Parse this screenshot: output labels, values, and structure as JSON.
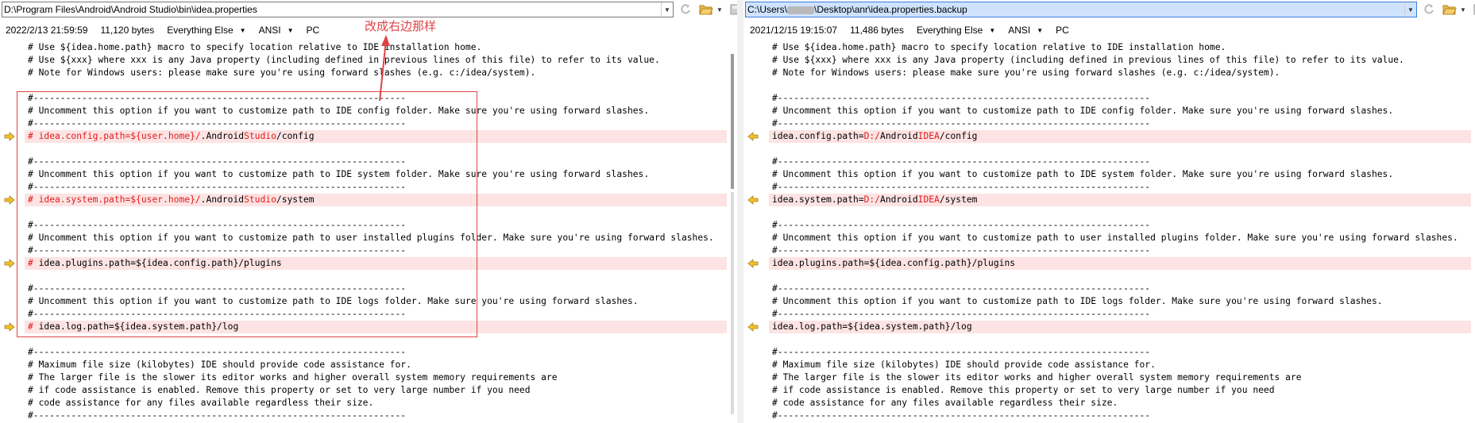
{
  "left": {
    "path": "D:\\Program Files\\Android\\Android Studio\\bin\\idea.properties",
    "date": "2022/2/13 21:59:59",
    "size": "11,120 bytes",
    "filter": "Everything Else",
    "encoding": "ANSI",
    "line_ending": "PC",
    "lines": [
      {
        "t": "# Use ${idea.home.path} macro to specify location relative to IDE installation home."
      },
      {
        "t": "# Use ${xxx} where xxx is any Java property (including defined in previous lines of this file) to refer to its value."
      },
      {
        "t": "# Note for Windows users: please make sure you're using forward slashes (e.g. c:/idea/system)."
      },
      {
        "t": ""
      },
      {
        "t": "#---------------------------------------------------------------------"
      },
      {
        "t": "# Uncomment this option if you want to customize path to IDE config folder. Make sure you're using forward slashes."
      },
      {
        "t": "#---------------------------------------------------------------------"
      },
      {
        "t": "",
        "diff": true,
        "parts": [
          [
            "# idea.config.path=",
            "r"
          ],
          [
            "${user.home}/",
            "r"
          ],
          [
            ".Android",
            ""
          ],
          [
            "Studio",
            "r"
          ],
          [
            "/config",
            ""
          ]
        ]
      },
      {
        "t": ""
      },
      {
        "t": "#---------------------------------------------------------------------"
      },
      {
        "t": "# Uncomment this option if you want to customize path to IDE system folder. Make sure you're using forward slashes."
      },
      {
        "t": "#---------------------------------------------------------------------"
      },
      {
        "t": "",
        "diff": true,
        "parts": [
          [
            "# idea.system.path=",
            "r"
          ],
          [
            "${user.home}/",
            "r"
          ],
          [
            ".Android",
            ""
          ],
          [
            "Studio",
            "r"
          ],
          [
            "/system",
            ""
          ]
        ]
      },
      {
        "t": ""
      },
      {
        "t": "#---------------------------------------------------------------------"
      },
      {
        "t": "# Uncomment this option if you want to customize path to user installed plugins folder. Make sure you're using forward slashes."
      },
      {
        "t": "#---------------------------------------------------------------------"
      },
      {
        "t": "",
        "diff": true,
        "parts": [
          [
            "# ",
            "r"
          ],
          [
            "idea.plugins.path=${idea.config.path}/plugins",
            ""
          ]
        ]
      },
      {
        "t": ""
      },
      {
        "t": "#---------------------------------------------------------------------"
      },
      {
        "t": "# Uncomment this option if you want to customize path to IDE logs folder. Make sure you're using forward slashes."
      },
      {
        "t": "#---------------------------------------------------------------------"
      },
      {
        "t": "",
        "diff": true,
        "parts": [
          [
            "# ",
            "r"
          ],
          [
            "idea.log.path=${idea.system.path}/log",
            ""
          ]
        ]
      },
      {
        "t": ""
      },
      {
        "t": "#---------------------------------------------------------------------"
      },
      {
        "t": "# Maximum file size (kilobytes) IDE should provide code assistance for."
      },
      {
        "t": "# The larger file is the slower its editor works and higher overall system memory requirements are"
      },
      {
        "t": "# if code assistance is enabled. Remove this property or set to very large number if you need"
      },
      {
        "t": "# code assistance for any files available regardless their size."
      },
      {
        "t": "#---------------------------------------------------------------------"
      }
    ]
  },
  "right": {
    "path_prefix": "C:\\Users\\",
    "path_suffix": "\\Desktop\\anr\\idea.properties.backup",
    "date": "2021/12/15 19:15:07",
    "size": "11,486 bytes",
    "filter": "Everything Else",
    "encoding": "ANSI",
    "line_ending": "PC",
    "lines": [
      {
        "t": "# Use ${idea.home.path} macro to specify location relative to IDE installation home."
      },
      {
        "t": "# Use ${xxx} where xxx is any Java property (including defined in previous lines of this file) to refer to its value."
      },
      {
        "t": "# Note for Windows users: please make sure you're using forward slashes (e.g. c:/idea/system)."
      },
      {
        "t": ""
      },
      {
        "t": "#---------------------------------------------------------------------"
      },
      {
        "t": "# Uncomment this option if you want to customize path to IDE config folder. Make sure you're using forward slashes."
      },
      {
        "t": "#---------------------------------------------------------------------"
      },
      {
        "t": "",
        "diff": true,
        "parts": [
          [
            "idea.config.path=",
            ""
          ],
          [
            "D:/",
            "r"
          ],
          [
            "Android",
            ""
          ],
          [
            "IDEA",
            "r"
          ],
          [
            "/config",
            ""
          ]
        ]
      },
      {
        "t": ""
      },
      {
        "t": "#---------------------------------------------------------------------"
      },
      {
        "t": "# Uncomment this option if you want to customize path to IDE system folder. Make sure you're using forward slashes."
      },
      {
        "t": "#---------------------------------------------------------------------"
      },
      {
        "t": "",
        "diff": true,
        "parts": [
          [
            "idea.system.path=",
            ""
          ],
          [
            "D:/",
            "r"
          ],
          [
            "Android",
            ""
          ],
          [
            "IDEA",
            "r"
          ],
          [
            "/system",
            ""
          ]
        ]
      },
      {
        "t": ""
      },
      {
        "t": "#---------------------------------------------------------------------"
      },
      {
        "t": "# Uncomment this option if you want to customize path to user installed plugins folder. Make sure you're using forward slashes."
      },
      {
        "t": "#---------------------------------------------------------------------"
      },
      {
        "t": "",
        "diff": true,
        "parts": [
          [
            "idea.plugins.path=${idea.config.path}/plugins",
            ""
          ]
        ]
      },
      {
        "t": ""
      },
      {
        "t": "#---------------------------------------------------------------------"
      },
      {
        "t": "# Uncomment this option if you want to customize path to IDE logs folder. Make sure you're using forward slashes."
      },
      {
        "t": "#---------------------------------------------------------------------"
      },
      {
        "t": "",
        "diff": true,
        "parts": [
          [
            "idea.log.path=${idea.system.path}/log",
            ""
          ]
        ]
      },
      {
        "t": ""
      },
      {
        "t": "#---------------------------------------------------------------------"
      },
      {
        "t": "# Maximum file size (kilobytes) IDE should provide code assistance for."
      },
      {
        "t": "# The larger file is the slower its editor works and higher overall system memory requirements are"
      },
      {
        "t": "# if code assistance is enabled. Remove this property or set to very large number if you need"
      },
      {
        "t": "# code assistance for any files available regardless their size."
      },
      {
        "t": "#---------------------------------------------------------------------"
      }
    ]
  },
  "annotation": {
    "text": "改成右边那样",
    "color": "#e04343"
  },
  "colors": {
    "diff_bg": "#fde3e3",
    "diff_text": "#e01b1b",
    "arrow": "#f2c12e"
  },
  "icons": [
    "refresh-icon",
    "open-folder-icon",
    "save-icon",
    "chevron-down-icon",
    "diff-arrow-right-icon",
    "diff-arrow-left-icon"
  ]
}
